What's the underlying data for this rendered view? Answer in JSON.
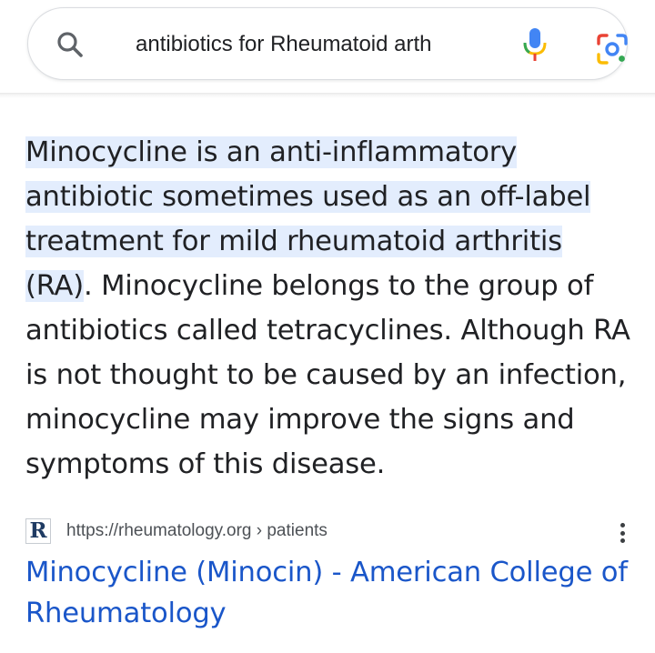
{
  "search": {
    "query": "antibiotics for Rheumatoid arth",
    "icons": {
      "left": "search-icon",
      "voice": "mic-icon",
      "camera": "google-lens-icon"
    },
    "colors": {
      "mic_blue": "#4285f4",
      "mic_red": "#ea4335",
      "lens_yellow": "#fbbc04",
      "lens_green": "#34a853"
    }
  },
  "snippet": {
    "highlighted": "Minocycline is an anti-inflammatory antibiotic sometimes used as an off-label treatment for mild rheumatoid arthritis (RA)",
    "rest": ". Minocycline belongs to the group of antibiotics called tetracyclines. Although RA is not thought to be caused by an infection, minocycline may improve the signs and symptoms of this disease.",
    "highlight_color": "#e3edfd"
  },
  "result": {
    "favicon_letter": "R",
    "url": "https://rheumatology.org › patients",
    "title": "Minocycline (Minocin) - American College of Rheumatology",
    "title_color": "#1a56c9"
  }
}
